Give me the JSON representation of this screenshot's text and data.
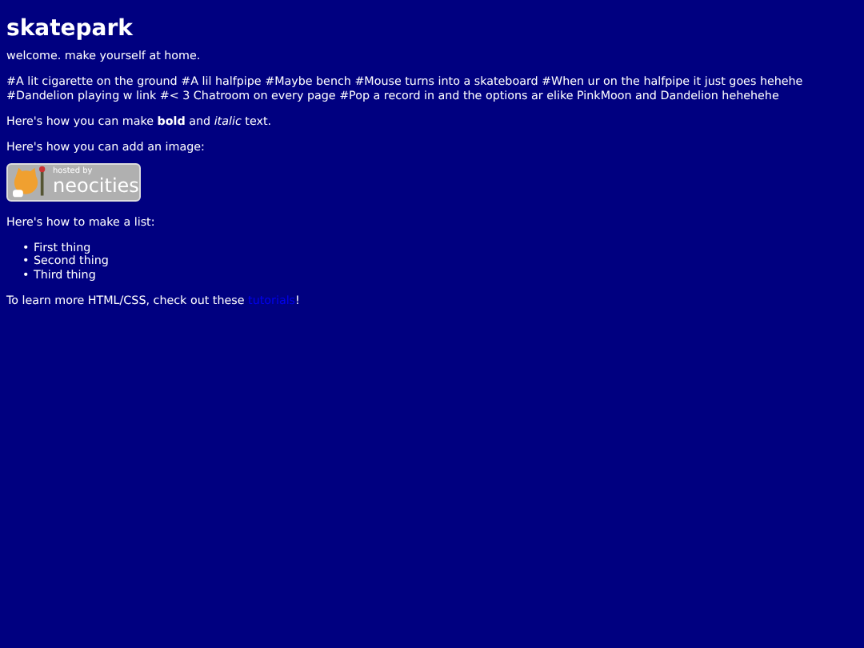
{
  "title": "skatepark",
  "welcome": "welcome. make yourself at home.",
  "tags": "#A lit cigarette on the ground #A lil halfpipe #Maybe bench #Mouse turns into a skateboard #When ur on the halfpipe it just goes hehehe #Dandelion playing w link #< 3 Chatroom on every page #Pop a record in and the options ar elike PinkMoon and Dandelion hehehehe",
  "bold_line": "Here's how you can make **bold** and *italic* text.",
  "image_line": "Here's how you can add an image:",
  "badge": {
    "small": "hosted by",
    "big": "neocities"
  },
  "list_line": "Here's how to make a list:",
  "list": [
    {
      "marker": "•",
      "text": "First thing"
    },
    {
      "marker": "•",
      "text": "Second thing"
    },
    {
      "marker": "•",
      "text": "Third thing"
    }
  ],
  "link_line": {
    "before": "To learn more HTML/CSS, check out these ",
    "link": "tutorials",
    "after": "!"
  }
}
